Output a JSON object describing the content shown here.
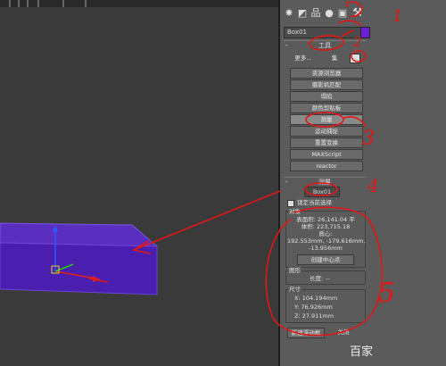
{
  "toolbar_icons": [
    "create-icon",
    "modify-icon",
    "hierarchy-icon",
    "motion-icon",
    "display-icon",
    "utilities-icon"
  ],
  "object_name": "Box01",
  "object_color": "#6a1fd0",
  "utilities_rollout": {
    "toggle": "-",
    "title": "工具",
    "more_label": "更多...",
    "sets_label": "集",
    "buttons": [
      "资源浏览器",
      "摄影机匹配",
      "塌陷",
      "颜色剪贴板",
      "测量",
      "运动捕捉",
      "重置变换",
      "MAXScript",
      "reactor"
    ],
    "active_button": "测量"
  },
  "measure_rollout": {
    "toggle": "-",
    "title": "测量",
    "object_name": "Box01",
    "lock_selection_label": "锁定当前选择",
    "objects_group": {
      "label": "对象",
      "surface_area": "表面积: 26,141.04 平",
      "volume": "体积: 223,715.18",
      "center_label": "质心:",
      "center_coords": "192.553mm, -179.616mm,",
      "center_z": "-13.956mm",
      "create_center_button": "创建中心点"
    },
    "shapes_group": {
      "label": "图形",
      "length_label": "长度:",
      "length_value": "--"
    },
    "dimensions_group": {
      "label": "尺寸",
      "x": "X:   104.194mm",
      "y": "Y:   76.926mm",
      "z": "Z:   27.911mm"
    },
    "new_floater_button": "新建浮动框",
    "close_button": "关闭"
  },
  "annotations": [
    "1",
    "2",
    "3",
    "4",
    "5"
  ],
  "watermark": "百家"
}
